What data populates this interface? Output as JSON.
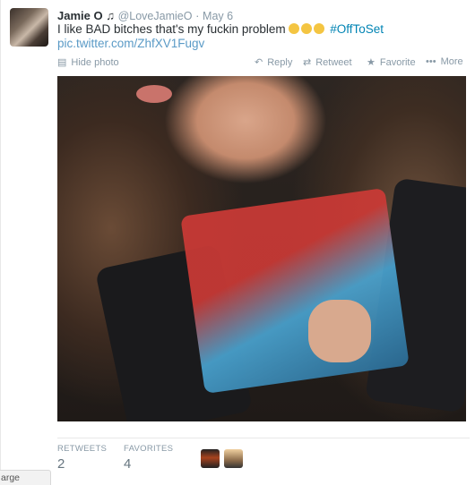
{
  "tweet": {
    "fullname": "Jamie O ♫",
    "screen_name": "@LoveJamieO",
    "separator": "·",
    "timestamp": "May 6",
    "text": "I like BAD bitches that's my fuckin problem",
    "hashtag": "#OffToSet",
    "pic_link": "pic.twitter.com/ZhfXV1Fugv"
  },
  "actions": {
    "hide_photo": "Hide photo",
    "reply": "Reply",
    "retweet": "Retweet",
    "favorite": "Favorite",
    "more": "More"
  },
  "icons": {
    "photo": "▤",
    "reply": "↶",
    "retweet": "⇄",
    "favorite": "★",
    "more": "•••"
  },
  "stats": {
    "retweets_label": "RETWEETS",
    "retweets_value": "2",
    "favorites_label": "FAVORITES",
    "favorites_value": "4"
  },
  "footer": {
    "large_tab": "arge"
  },
  "colors": {
    "link": "#0084b4",
    "muted": "#8899a6"
  }
}
